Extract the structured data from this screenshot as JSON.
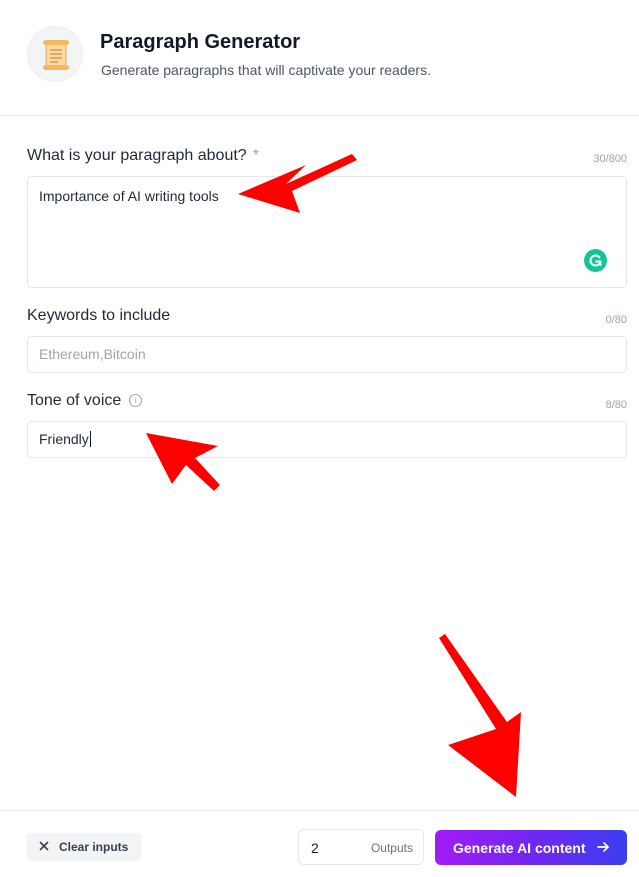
{
  "header": {
    "icon": "scroll-document-icon",
    "title": "Paragraph Generator",
    "subtitle": "Generate paragraphs that will captivate your readers."
  },
  "fields": {
    "topic": {
      "label": "What is your paragraph about?",
      "required_marker": "*",
      "counter": "30/800",
      "value": "Importance of AI writing tools"
    },
    "keywords": {
      "label": "Keywords to include",
      "counter": "0/80",
      "value": "",
      "placeholder": "Ethereum,Bitcoin"
    },
    "tone": {
      "label": "Tone of voice",
      "info_icon": "info-icon",
      "counter": "8/80",
      "value": "Friendly"
    }
  },
  "footer": {
    "clear_label": "Clear inputs",
    "outputs_value": "2",
    "outputs_label": "Outputs",
    "generate_label": "Generate AI content",
    "generate_icon": "arrow-right-icon"
  },
  "colors": {
    "accent_gradient_start": "#a21bf5",
    "accent_gradient_end": "#3b3ff0",
    "annotation_arrow": "#ff0000",
    "grammarly": "#15c39a"
  }
}
